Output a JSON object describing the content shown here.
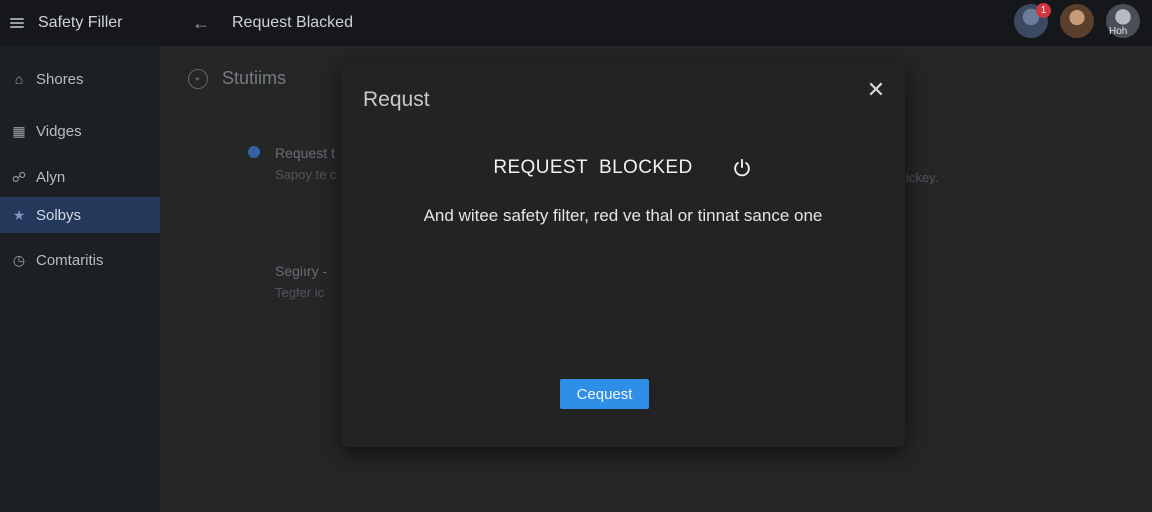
{
  "app": {
    "title": "Safety Filler"
  },
  "header": {
    "back_icon": "arrow-left-icon",
    "title": "Request Blacked"
  },
  "user_avatars": [
    {
      "badge": "1"
    },
    {},
    {
      "label": "Hoh"
    }
  ],
  "sidebar": {
    "items": [
      {
        "label": "Shores",
        "icon": "home-icon",
        "active": false
      },
      {
        "label": "Vidges",
        "icon": "chart-icon",
        "active": false
      },
      {
        "label": "Alyn",
        "icon": "link-icon",
        "active": false
      },
      {
        "label": "Solbys",
        "icon": "star-icon",
        "active": true
      },
      {
        "label": "Comtaritis",
        "icon": "clock-icon",
        "active": false
      }
    ]
  },
  "main": {
    "section_title": "Stutiims",
    "rows": [
      {
        "label": "Request t",
        "sub": "Sapoy te c"
      },
      {
        "label": "Segiıry -",
        "sub": "Tegfer ic"
      }
    ],
    "right_fragment": "ickey."
  },
  "modal": {
    "header": "Requst",
    "title": "REQUEST  BLOCKED",
    "message": "And witee safety filter, red ve thal or tinnat sance one",
    "button_label": "Cequest"
  },
  "colors": {
    "accent": "#2f8ee8",
    "sidebar_active": "#23385a",
    "badge": "#d0363b"
  }
}
